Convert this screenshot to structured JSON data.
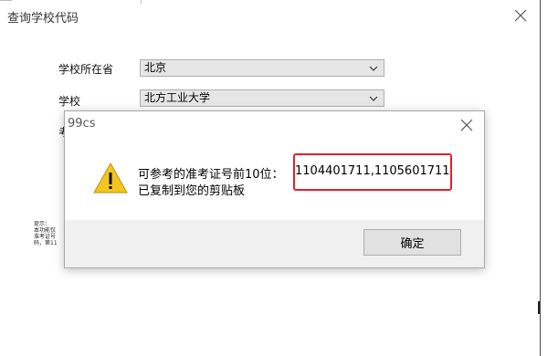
{
  "main_window": {
    "title": "查询学校代码",
    "province_label": "学校所在省",
    "province_value": "北京",
    "school_label": "学校",
    "school_value": "北方工业大学",
    "partial_label": "考",
    "hint_lines": [
      "提示：",
      "本功能仅",
      "准考证号",
      "码，第11"
    ]
  },
  "dialog": {
    "title": "99cs",
    "message_prefix": "可参考的准考证号前10位：",
    "codes": "1104401711,1105601711",
    "message_line2": "已复制到您的剪贴板",
    "ok_label": "确定"
  },
  "colors": {
    "highlight_border": "#e3202b",
    "warning_fill": "#f2c521"
  },
  "icons": {
    "close": "close-icon",
    "dropdown": "chevron-down-icon",
    "warning": "warning-icon"
  }
}
